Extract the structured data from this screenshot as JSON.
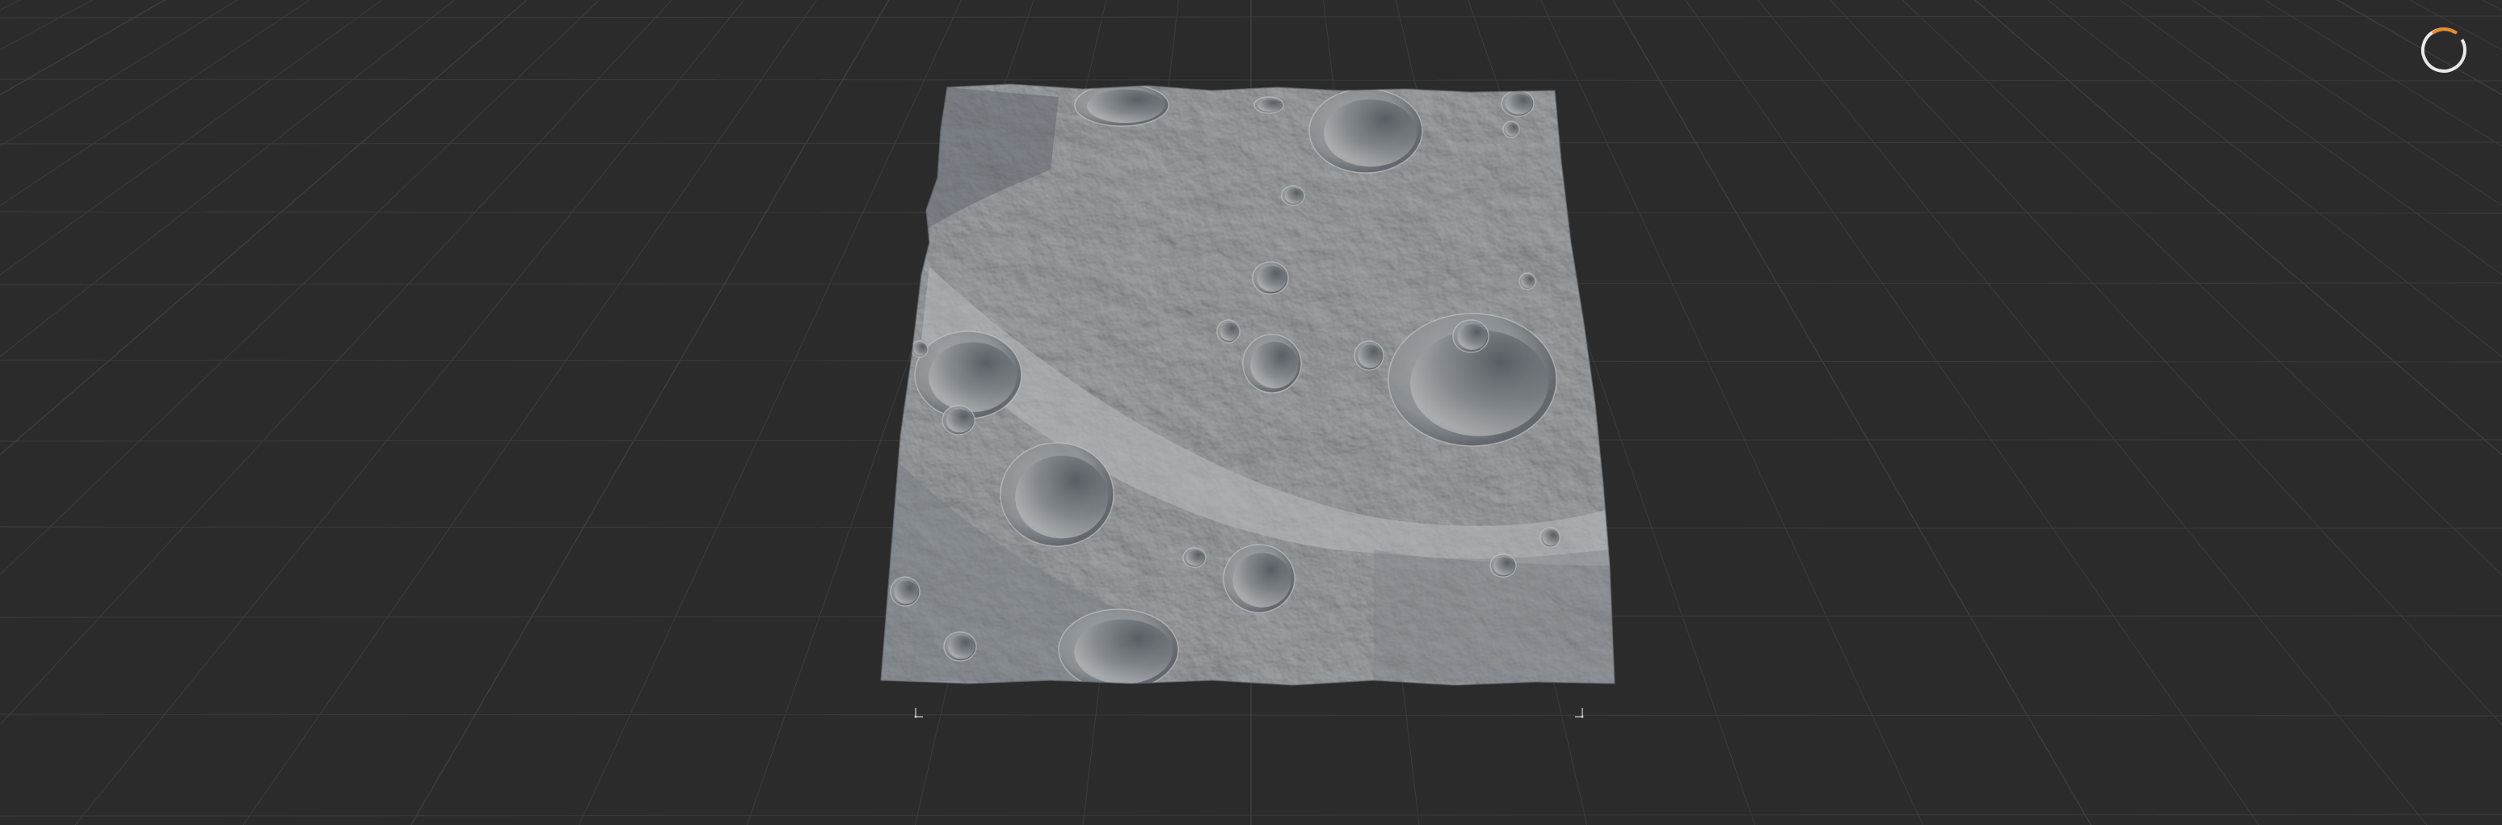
{
  "viewport": {
    "background_color": "#2b2b2b",
    "grid_color": "#3c3c3c",
    "grid_major_color": "#444444",
    "terrain_color": "#8e9296",
    "terrain_shadow_color": "#4c5258",
    "terrain_highlight_color": "#c9cccd"
  },
  "nav_gizmo": {
    "icon": "orbit-ring-icon",
    "ring_color": "#e8e8e8",
    "accent_color": "#e8892b"
  },
  "axis_markers": {
    "left_icon": "axis-origin-icon",
    "right_icon": "axis-end-icon",
    "marker_color": "#d8d8d8"
  }
}
